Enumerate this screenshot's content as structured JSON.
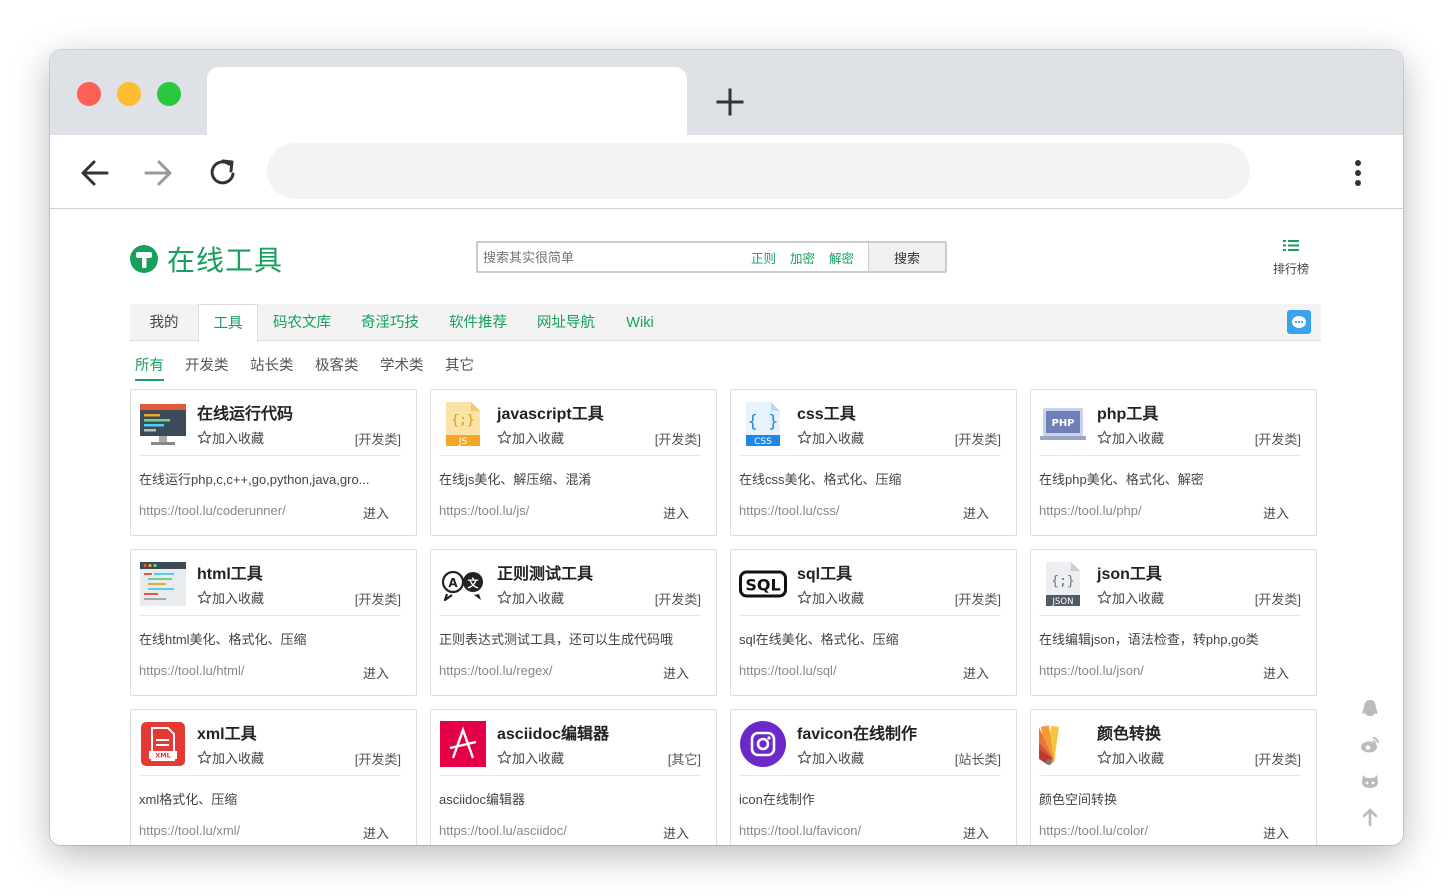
{
  "browser": {
    "new_tab_symbol": "+",
    "address": ""
  },
  "site": {
    "logo_text": "在线工具",
    "search": {
      "placeholder": "搜索其实很简单",
      "quick_tags": [
        "正则",
        "加密",
        "解密"
      ],
      "button": "搜索"
    },
    "rank_label": "排行榜",
    "top_nav": [
      "我的",
      "工具",
      "码农文库",
      "奇淫巧技",
      "软件推荐",
      "网址导航",
      "Wiki"
    ],
    "top_nav_active": "工具",
    "sub_nav": [
      "所有",
      "开发类",
      "站长类",
      "极客类",
      "学术类",
      "其它"
    ],
    "sub_nav_active": "所有",
    "accent_color": "#17a05d"
  },
  "tools": [
    {
      "name": "在线运行代码",
      "icon": "code-runner-icon",
      "fav": "加入收藏",
      "category": "[开发类]",
      "desc": "在线运行php,c,c++,go,python,java,gro...",
      "url": "https://tool.lu/coderunner/",
      "enter": "进入"
    },
    {
      "name": "javascript工具",
      "icon": "js-file-icon",
      "fav": "加入收藏",
      "category": "[开发类]",
      "desc": "在线js美化、解压缩、混淆",
      "url": "https://tool.lu/js/",
      "enter": "进入"
    },
    {
      "name": "css工具",
      "icon": "css-file-icon",
      "fav": "加入收藏",
      "category": "[开发类]",
      "desc": "在线css美化、格式化、压缩",
      "url": "https://tool.lu/css/",
      "enter": "进入"
    },
    {
      "name": "php工具",
      "icon": "php-laptop-icon",
      "fav": "加入收藏",
      "category": "[开发类]",
      "desc": "在线php美化、格式化、解密",
      "url": "https://tool.lu/php/",
      "enter": "进入"
    },
    {
      "name": "html工具",
      "icon": "html-editor-icon",
      "fav": "加入收藏",
      "category": "[开发类]",
      "desc": "在线html美化、格式化、压缩",
      "url": "https://tool.lu/html/",
      "enter": "进入"
    },
    {
      "name": "正则测试工具",
      "icon": "regex-bubble-icon",
      "fav": "加入收藏",
      "category": "[开发类]",
      "desc": "正则表达式测试工具，还可以生成代码哦",
      "url": "https://tool.lu/regex/",
      "enter": "进入"
    },
    {
      "name": "sql工具",
      "icon": "sql-badge-icon",
      "fav": "加入收藏",
      "category": "[开发类]",
      "desc": "sql在线美化、格式化、压缩",
      "url": "https://tool.lu/sql/",
      "enter": "进入"
    },
    {
      "name": "json工具",
      "icon": "json-file-icon",
      "fav": "加入收藏",
      "category": "[开发类]",
      "desc": "在线编辑json，语法检查，转php,go类",
      "url": "https://tool.lu/json/",
      "enter": "进入"
    },
    {
      "name": "xml工具",
      "icon": "xml-file-icon",
      "fav": "加入收藏",
      "category": "[开发类]",
      "desc": "xml格式化、压缩",
      "url": "https://tool.lu/xml/",
      "enter": "进入"
    },
    {
      "name": "asciidoc编辑器",
      "icon": "asciidoc-icon",
      "fav": "加入收藏",
      "category": "[其它]",
      "desc": "asciidoc编辑器",
      "url": "https://tool.lu/asciidoc/",
      "enter": "进入"
    },
    {
      "name": "favicon在线制作",
      "icon": "favicon-camera-icon",
      "fav": "加入收藏",
      "category": "[站长类]",
      "desc": "icon在线制作",
      "url": "https://tool.lu/favicon/",
      "enter": "进入"
    },
    {
      "name": "颜色转换",
      "icon": "color-palette-icon",
      "fav": "加入收藏",
      "category": "[开发类]",
      "desc": "颜色空间转换",
      "url": "https://tool.lu/color/",
      "enter": "进入"
    }
  ],
  "side_tools": [
    "qq-penguin-icon",
    "weibo-icon",
    "github-icon",
    "back-to-top-icon"
  ]
}
